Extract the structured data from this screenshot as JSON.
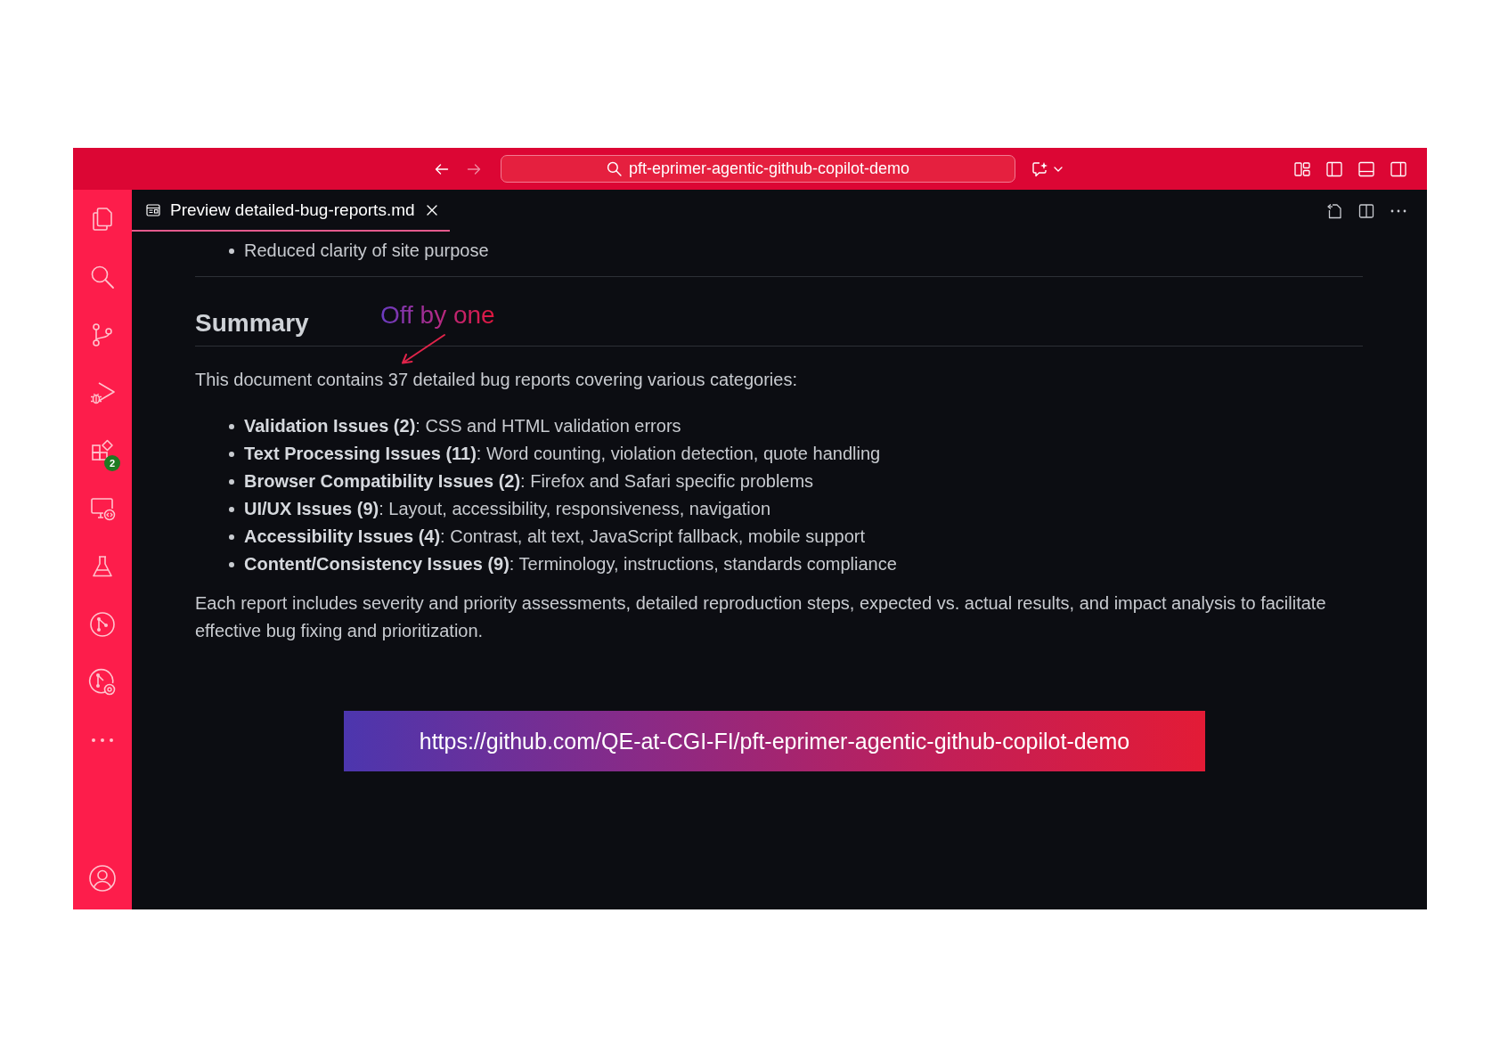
{
  "title_bar": {
    "nav_buttons": [
      {
        "kind": "back",
        "disabled": false
      },
      {
        "kind": "forward",
        "disabled": true
      }
    ],
    "search": {
      "value": "pft-eprimer-agentic-github-copilot-demo"
    }
  },
  "activity_bar": {
    "badge": "2"
  },
  "tabs": [
    {
      "label": "Preview detailed-bug-reports.md",
      "selected": true
    }
  ],
  "document": {
    "blocks": [
      {
        "kind": "list",
        "items": [
          "Reduced clarity of site purpose"
        ]
      },
      {
        "kind": "rule"
      },
      {
        "kind": "heading",
        "text": "Summary"
      },
      {
        "kind": "paragraph",
        "text": "This document contains 37 detailed bug reports covering various categories:"
      },
      {
        "kind": "list",
        "items": [
          "**Validation Issues (2)**: CSS and HTML validation errors",
          "**Text Processing Issues (11)**: Word counting, violation detection, quote handling",
          "**Browser Compatibility Issues (2)**: Firefox and Safari specific problems",
          "**UI/UX Issues (9)**: Layout, accessibility, responsiveness, navigation",
          "**Accessibility Issues (4)**: Contrast, alt text, JavaScript fallback, mobile support",
          "**Content/Consistency Issues (9)**: Terminology, instructions, standards compliance"
        ]
      },
      {
        "kind": "paragraph",
        "text": "Each report includes severity and priority assessments, detailed reproduction steps, expected vs. actual results, and impact analysis to facilitate effective bug fixing and prioritization."
      }
    ]
  },
  "annotation": {
    "text": "Off by one"
  },
  "banner": {
    "text": "https://github.com/QE-at-CGI-FI/pft-eprimer-agentic-github-copilot-demo"
  }
}
